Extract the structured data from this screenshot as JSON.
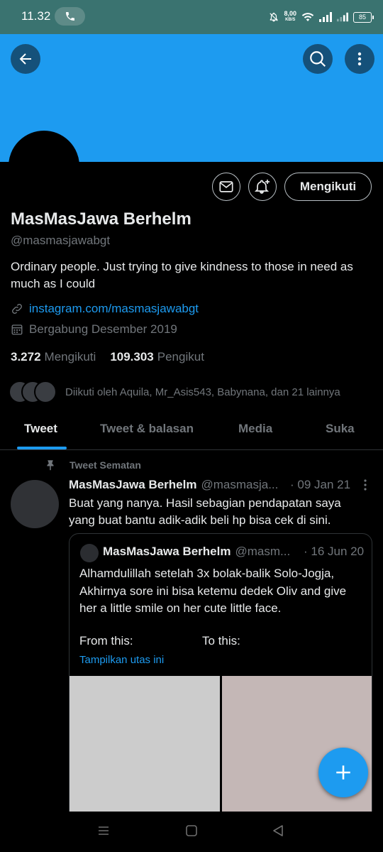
{
  "status_bar": {
    "time": "11.32",
    "net_speed": "8,00",
    "net_unit": "KB/S",
    "battery": "85"
  },
  "profile": {
    "name": "MasMasJawa Berhelm",
    "handle": "@masmasjawabgt",
    "bio": "Ordinary people. Just trying to give kindness to those in need as much as I could",
    "link": "instagram.com/masmasjawabgt",
    "joined": "Bergabung Desember 2019",
    "following_count": "3.272",
    "following_label": "Mengikuti",
    "followers_count": "109.303",
    "followers_label": "Pengikut",
    "followed_by": "Diikuti oleh Aquila, Mr_Asis543, Babynana, dan 21 lainnya",
    "follow_button": "Mengikuti"
  },
  "tabs": [
    "Tweet",
    "Tweet & balasan",
    "Media",
    "Suka"
  ],
  "pinned_tweet": {
    "pinned_label": "Tweet Sematan",
    "name": "MasMasJawa Berhelm",
    "handle": "@masmasja...",
    "separator": "·",
    "date": "09 Jan 21",
    "text": "Buat yang nanya. Hasil sebagian pendapatan saya yang buat bantu adik-adik beli hp bisa cek di sini.",
    "quote": {
      "name": "MasMasJawa Berhelm",
      "handle": "@masm...",
      "date": "16 Jun 20",
      "text": "Alhamdulillah setelah 3x bolak-balik Solo-Jogja, Akhirnya sore ini bisa ketemu dedek Oliv and give her a little smile on her cute little face.",
      "from_label": "From this:",
      "to_label": "To this:",
      "show_thread": "Tampilkan utas ini"
    }
  },
  "colors": {
    "banner": "#1d9bf0",
    "accent": "#1d9bf0",
    "status_bar": "#3a7370",
    "background": "#000000",
    "secondary_text": "#71767b"
  },
  "icons": [
    "phone-icon",
    "bell-mute-icon",
    "wifi-icon",
    "signal-icon",
    "battery-icon",
    "back-arrow-icon",
    "search-icon",
    "more-vertical-icon",
    "mail-icon",
    "bell-plus-icon",
    "link-icon",
    "calendar-icon",
    "pin-icon",
    "plus-icon",
    "menu-icon",
    "home-square-icon",
    "back-triangle-icon"
  ]
}
